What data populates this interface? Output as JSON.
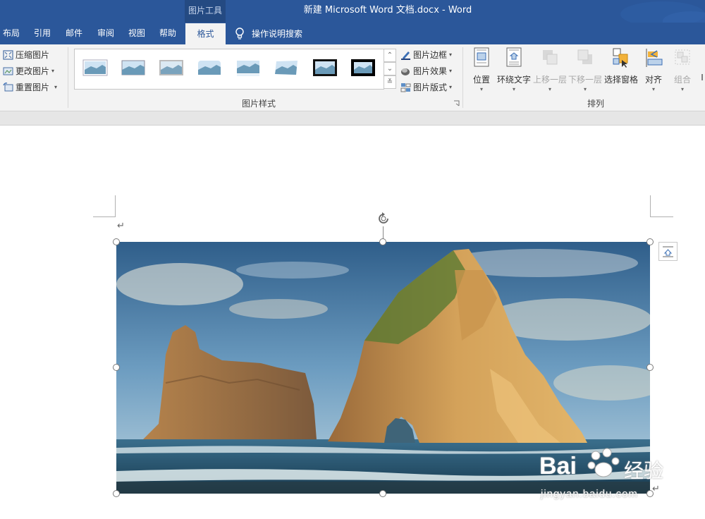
{
  "titlebar": {
    "context_tool": "图片工具",
    "doc_title": "新建 Microsoft Word 文档.docx  -  Word"
  },
  "tabs": [
    {
      "label": "布局"
    },
    {
      "label": "引用"
    },
    {
      "label": "邮件"
    },
    {
      "label": "审阅"
    },
    {
      "label": "视图"
    },
    {
      "label": "帮助"
    },
    {
      "label": "格式",
      "active": true
    }
  ],
  "tellme": {
    "label": "操作说明搜索",
    "icon": "lightbulb-icon"
  },
  "ribbon": {
    "adjust": {
      "compress": "压缩图片",
      "change": "更改图片",
      "reset": "重置图片"
    },
    "styles": {
      "group_label": "图片样式",
      "border": "图片边框",
      "effects": "图片效果",
      "layout": "图片版式"
    },
    "arrange": {
      "group_label": "排列",
      "position": "位置",
      "wrap_text": "环绕文字",
      "bring_forward": "上移一层",
      "send_backward": "下移一层",
      "selection_pane": "选择窗格",
      "align": "对齐",
      "group": "组合",
      "rotate_partial": "I"
    }
  },
  "watermark": {
    "text": "Bai",
    "text2": "经验",
    "url": "jingyan.baidu.com"
  },
  "colors": {
    "ribbon_blue": "#2b579a",
    "ribbon_bg": "#f3f3f3"
  }
}
